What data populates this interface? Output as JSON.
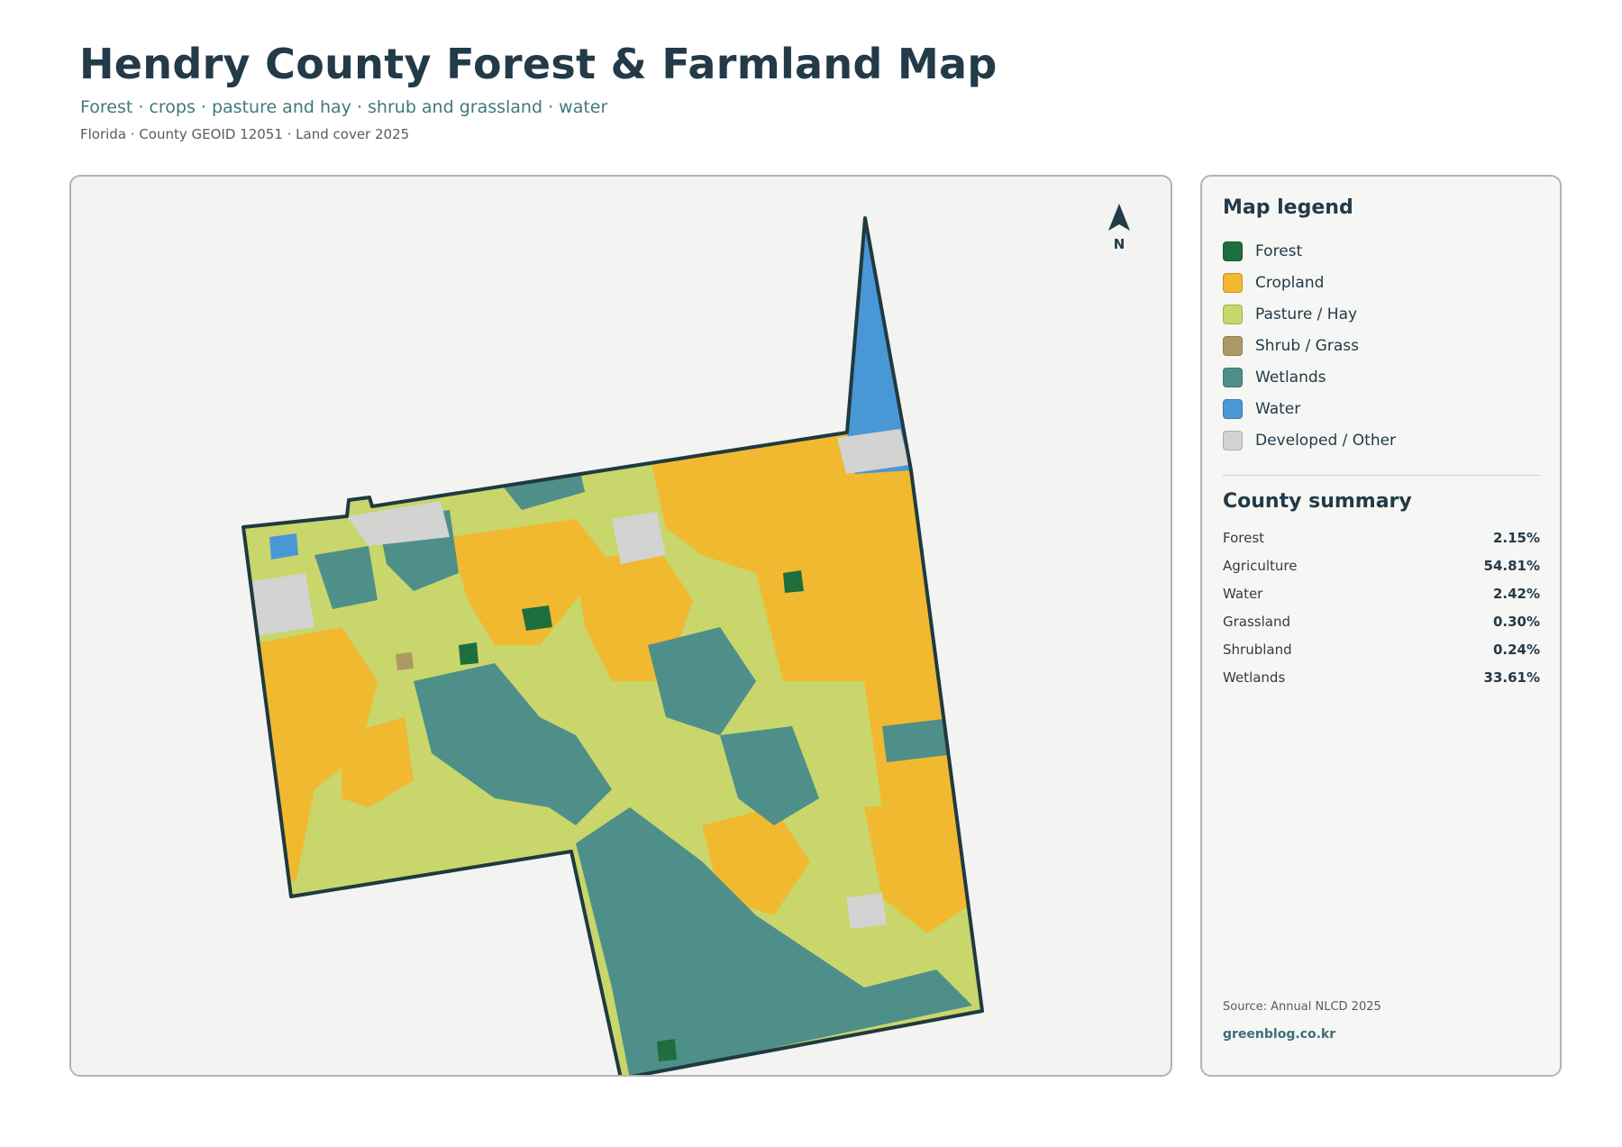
{
  "header": {
    "title": "Hendry County Forest & Farmland Map",
    "subtitle": "Forest · crops · pasture and hay · shrub and grassland · water",
    "meta": "Florida · County GEOID 12051 · Land cover 2025"
  },
  "map": {
    "north_label": "N",
    "colors": {
      "forest": "#1f6e3d",
      "cropland": "#f0b92f",
      "pasture": "#c8d66b",
      "shrub": "#ab9a63",
      "wetlands": "#4f8f8a",
      "water": "#4a97d6",
      "developed": "#d3d3d1",
      "boundary": "#1f3a40",
      "background": "#f3f3f1"
    }
  },
  "legend": {
    "title": "Map legend",
    "items": [
      {
        "label": "Forest",
        "color": "#1f6e3d"
      },
      {
        "label": "Cropland",
        "color": "#f0b92f"
      },
      {
        "label": "Pasture / Hay",
        "color": "#c8d66b"
      },
      {
        "label": "Shrub / Grass",
        "color": "#ab9a63"
      },
      {
        "label": "Wetlands",
        "color": "#4f8f8a"
      },
      {
        "label": "Water",
        "color": "#4a97d6"
      },
      {
        "label": "Developed / Other",
        "color": "#d3d3d1"
      }
    ]
  },
  "summary": {
    "title": "County summary",
    "rows": [
      {
        "label": "Forest",
        "value": "2.15%"
      },
      {
        "label": "Agriculture",
        "value": "54.81%"
      },
      {
        "label": "Water",
        "value": "2.42%"
      },
      {
        "label": "Grassland",
        "value": "0.30%"
      },
      {
        "label": "Shrubland",
        "value": "0.24%"
      },
      {
        "label": "Wetlands",
        "value": "33.61%"
      }
    ]
  },
  "footer": {
    "source": "Source: Annual NLCD 2025",
    "credit": "greenblog.co.kr"
  }
}
